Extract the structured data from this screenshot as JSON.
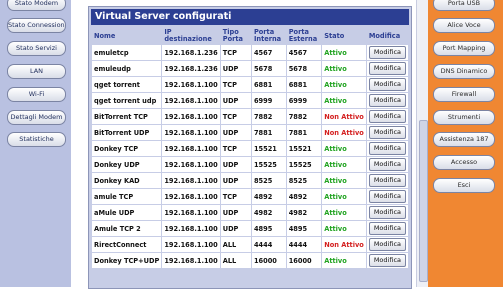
{
  "left_nav": [
    {
      "label": "Stato Modem"
    },
    {
      "label": "Stato Connessione"
    },
    {
      "label": "Stato Servizi"
    },
    {
      "label": "LAN"
    },
    {
      "label": "Wi-Fi"
    },
    {
      "label": "Dettagli Modem"
    },
    {
      "label": "Statistiche"
    }
  ],
  "right_nav": [
    {
      "label": "Porta USB"
    },
    {
      "label": "Alice Voce"
    },
    {
      "label": "Port Mapping"
    },
    {
      "label": "DNS Dinamico"
    },
    {
      "label": "Firewall"
    },
    {
      "label": "Strumenti"
    },
    {
      "label": "Assistenza 187"
    },
    {
      "label": "Accesso"
    },
    {
      "label": "Esci"
    }
  ],
  "panel": {
    "title": "Virtual Server configurati",
    "headers": {
      "nome": "Nome",
      "ip": "IP destinazione",
      "tipo": "Tipo Porta",
      "interna": "Porta Interna",
      "esterna": "Porta Esterna",
      "stato": "Stato",
      "modifica": "Modifica"
    },
    "rows": [
      {
        "nome": "emuletcp",
        "ip": "192.168.1.236",
        "tipo": "TCP",
        "interna": "4567",
        "esterna": "4567",
        "stato": "Attivo",
        "active": true,
        "btn": "Modifica"
      },
      {
        "nome": "emuleudp",
        "ip": "192.168.1.236",
        "tipo": "UDP",
        "interna": "5678",
        "esterna": "5678",
        "stato": "Attivo",
        "active": true,
        "btn": "Modifica"
      },
      {
        "nome": "qget torrent",
        "ip": "192.168.1.100",
        "tipo": "TCP",
        "interna": "6881",
        "esterna": "6881",
        "stato": "Attivo",
        "active": true,
        "btn": "Modifica"
      },
      {
        "nome": "qget torrent udp",
        "ip": "192.168.1.100",
        "tipo": "UDP",
        "interna": "6999",
        "esterna": "6999",
        "stato": "Attivo",
        "active": true,
        "btn": "Modifica"
      },
      {
        "nome": "BitTorrent TCP",
        "ip": "192.168.1.100",
        "tipo": "TCP",
        "interna": "7882",
        "esterna": "7882",
        "stato": "Non Attivo",
        "active": false,
        "btn": "Modifica"
      },
      {
        "nome": "BitTorrent UDP",
        "ip": "192.168.1.100",
        "tipo": "UDP",
        "interna": "7881",
        "esterna": "7881",
        "stato": "Non Attivo",
        "active": false,
        "btn": "Modifica"
      },
      {
        "nome": "Donkey TCP",
        "ip": "192.168.1.100",
        "tipo": "TCP",
        "interna": "15521",
        "esterna": "15521",
        "stato": "Attivo",
        "active": true,
        "btn": "Modifica"
      },
      {
        "nome": "Donkey UDP",
        "ip": "192.168.1.100",
        "tipo": "UDP",
        "interna": "15525",
        "esterna": "15525",
        "stato": "Attivo",
        "active": true,
        "btn": "Modifica"
      },
      {
        "nome": "Donkey KAD",
        "ip": "192.168.1.100",
        "tipo": "UDP",
        "interna": "8525",
        "esterna": "8525",
        "stato": "Attivo",
        "active": true,
        "btn": "Modifica"
      },
      {
        "nome": "amule TCP",
        "ip": "192.168.1.100",
        "tipo": "TCP",
        "interna": "4892",
        "esterna": "4892",
        "stato": "Attivo",
        "active": true,
        "btn": "Modifica"
      },
      {
        "nome": "aMule UDP",
        "ip": "192.168.1.100",
        "tipo": "UDP",
        "interna": "4982",
        "esterna": "4982",
        "stato": "Attivo",
        "active": true,
        "btn": "Modifica"
      },
      {
        "nome": "Amule TCP 2",
        "ip": "192.168.1.100",
        "tipo": "UDP",
        "interna": "4895",
        "esterna": "4895",
        "stato": "Attivo",
        "active": true,
        "btn": "Modifica"
      },
      {
        "nome": "RirectConnect",
        "ip": "192.168.1.100",
        "tipo": "ALL",
        "interna": "4444",
        "esterna": "4444",
        "stato": "Non Attivo",
        "active": false,
        "btn": "Modifica"
      },
      {
        "nome": "Donkey TCP+UDP",
        "ip": "192.168.1.100",
        "tipo": "ALL",
        "interna": "16000",
        "esterna": "16000",
        "stato": "Attivo",
        "active": true,
        "btn": "Modifica"
      }
    ]
  },
  "colors": {
    "title_bar": "#2c3f93",
    "active": "#21a321",
    "inactive": "#d42020",
    "left_bg": "#b9c1e1",
    "right_bg": "#f08732"
  }
}
